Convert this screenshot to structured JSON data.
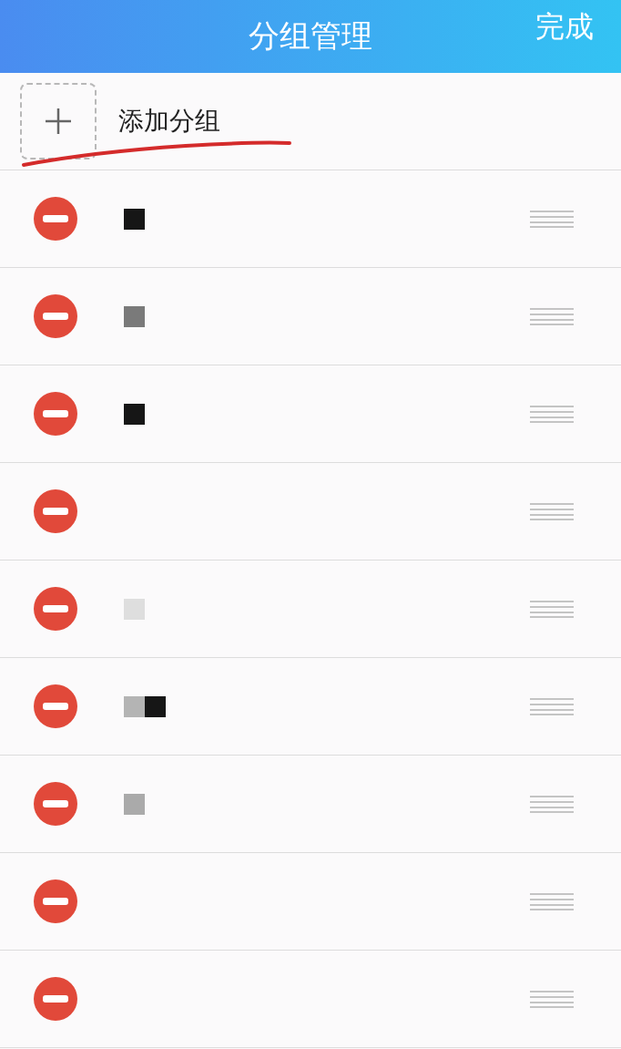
{
  "header": {
    "title": "分组管理",
    "done": "完成"
  },
  "add_group": {
    "label": "添加分组"
  },
  "groups": [
    {
      "redacted": true,
      "blocks": [
        {
          "color": "#161616"
        }
      ]
    },
    {
      "redacted": true,
      "blocks": [
        {
          "color": "#7a7a7a"
        }
      ]
    },
    {
      "redacted": true,
      "blocks": [
        {
          "color": "#161616"
        }
      ]
    },
    {
      "redacted": false
    },
    {
      "redacted": true,
      "blocks": [
        {
          "color": "#dedede"
        }
      ]
    },
    {
      "redacted": true,
      "blocks": [
        {
          "color": "#b4b4b4"
        },
        {
          "color": "#161616"
        }
      ]
    },
    {
      "redacted": true,
      "blocks": [
        {
          "color": "#aaaaaa"
        }
      ]
    },
    {
      "redacted": false
    },
    {
      "redacted": false
    }
  ]
}
